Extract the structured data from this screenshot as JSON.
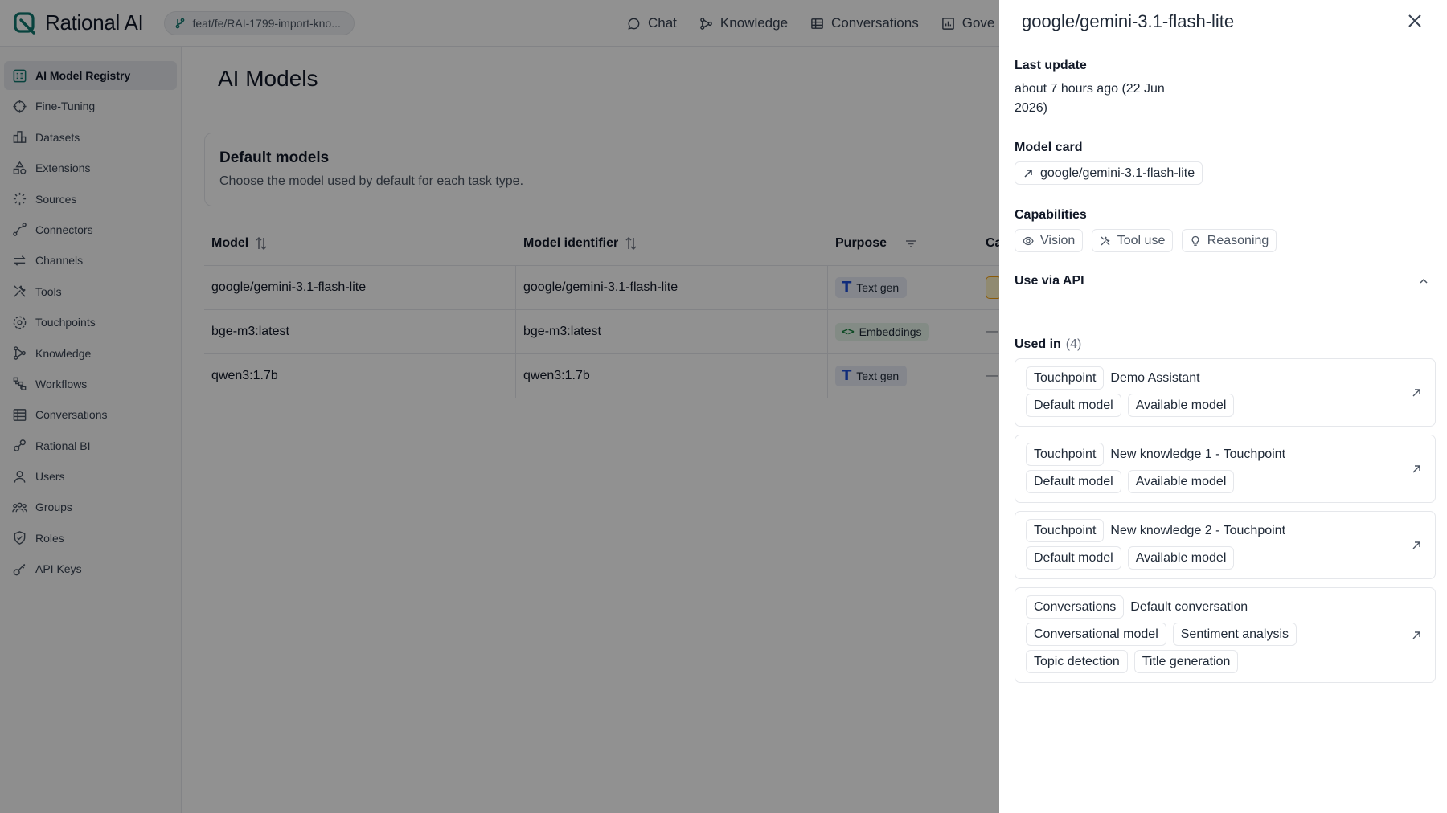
{
  "app": {
    "name": "Rational AI",
    "branch": "feat/fe/RAI-1799-import-kno...",
    "accent": "#0f766e"
  },
  "topnav": [
    {
      "label": "Chat",
      "icon": "chat-bubble-icon"
    },
    {
      "label": "Knowledge",
      "icon": "knowledge-graph-icon"
    },
    {
      "label": "Conversations",
      "icon": "table-icon"
    },
    {
      "label": "Gove",
      "icon": "bar-chart-icon"
    }
  ],
  "sidebar": {
    "items": [
      {
        "label": "AI Model Registry",
        "icon": "model-registry-icon",
        "active": true
      },
      {
        "label": "Fine-Tuning",
        "icon": "crosshair-icon"
      },
      {
        "label": "Datasets",
        "icon": "dataset-icon"
      },
      {
        "label": "Extensions",
        "icon": "shapes-icon"
      },
      {
        "label": "Sources",
        "icon": "sources-icon"
      },
      {
        "label": "Connectors",
        "icon": "connector-icon"
      },
      {
        "label": "Channels",
        "icon": "arrows-icon"
      },
      {
        "label": "Tools",
        "icon": "tools-icon"
      },
      {
        "label": "Touchpoints",
        "icon": "touchpoint-icon"
      },
      {
        "label": "Knowledge",
        "icon": "knowledge-graph-icon"
      },
      {
        "label": "Workflows",
        "icon": "workflow-icon"
      },
      {
        "label": "Conversations",
        "icon": "table-icon"
      },
      {
        "label": "Rational BI",
        "icon": "bi-icon"
      },
      {
        "label": "Users",
        "icon": "user-icon"
      },
      {
        "label": "Groups",
        "icon": "group-icon"
      },
      {
        "label": "Roles",
        "icon": "shield-check-icon"
      },
      {
        "label": "API Keys",
        "icon": "key-icon"
      }
    ]
  },
  "main": {
    "title": "AI Models",
    "default_models": {
      "title": "Default models",
      "description": "Choose the model used by default for each task type."
    },
    "table": {
      "headers": [
        "Model",
        "Model identifier",
        "Purpose",
        "Ca"
      ],
      "rows": [
        {
          "model": "google/gemini-3.1-flash-lite",
          "identifier": "google/gemini-3.1-flash-lite",
          "purpose": "Text gen",
          "purpose_type": "text",
          "capability": "chip"
        },
        {
          "model": "bge-m3:latest",
          "identifier": "bge-m3:latest",
          "purpose": "Embeddings",
          "purpose_type": "embed",
          "capability": "—"
        },
        {
          "model": "qwen3:1.7b",
          "identifier": "qwen3:1.7b",
          "purpose": "Text gen",
          "purpose_type": "text",
          "capability": "—"
        }
      ]
    }
  },
  "drawer": {
    "title": "google/gemini-3.1-flash-lite",
    "last_update_label": "Last update",
    "last_update_value": "about 7 hours ago (22 Jun 2026)",
    "model_card_label": "Model card",
    "model_card_link": "google/gemini-3.1-flash-lite",
    "capabilities_label": "Capabilities",
    "capabilities": [
      "Vision",
      "Tool use",
      "Reasoning"
    ],
    "api_label": "Use via API",
    "used_in_label": "Used in",
    "used_in_count": "(4)",
    "used_in": [
      {
        "type": "Touchpoint",
        "name": "Demo Assistant",
        "roles": [
          "Default model",
          "Available model"
        ]
      },
      {
        "type": "Touchpoint",
        "name": "New knowledge 1 - Touchpoint",
        "roles": [
          "Default model",
          "Available model"
        ]
      },
      {
        "type": "Touchpoint",
        "name": "New knowledge 2 - Touchpoint",
        "roles": [
          "Default model",
          "Available model"
        ]
      },
      {
        "type": "Conversations",
        "name": "Default conversation",
        "roles": [
          "Conversational model",
          "Sentiment analysis",
          "Topic detection",
          "Title generation"
        ]
      }
    ]
  }
}
